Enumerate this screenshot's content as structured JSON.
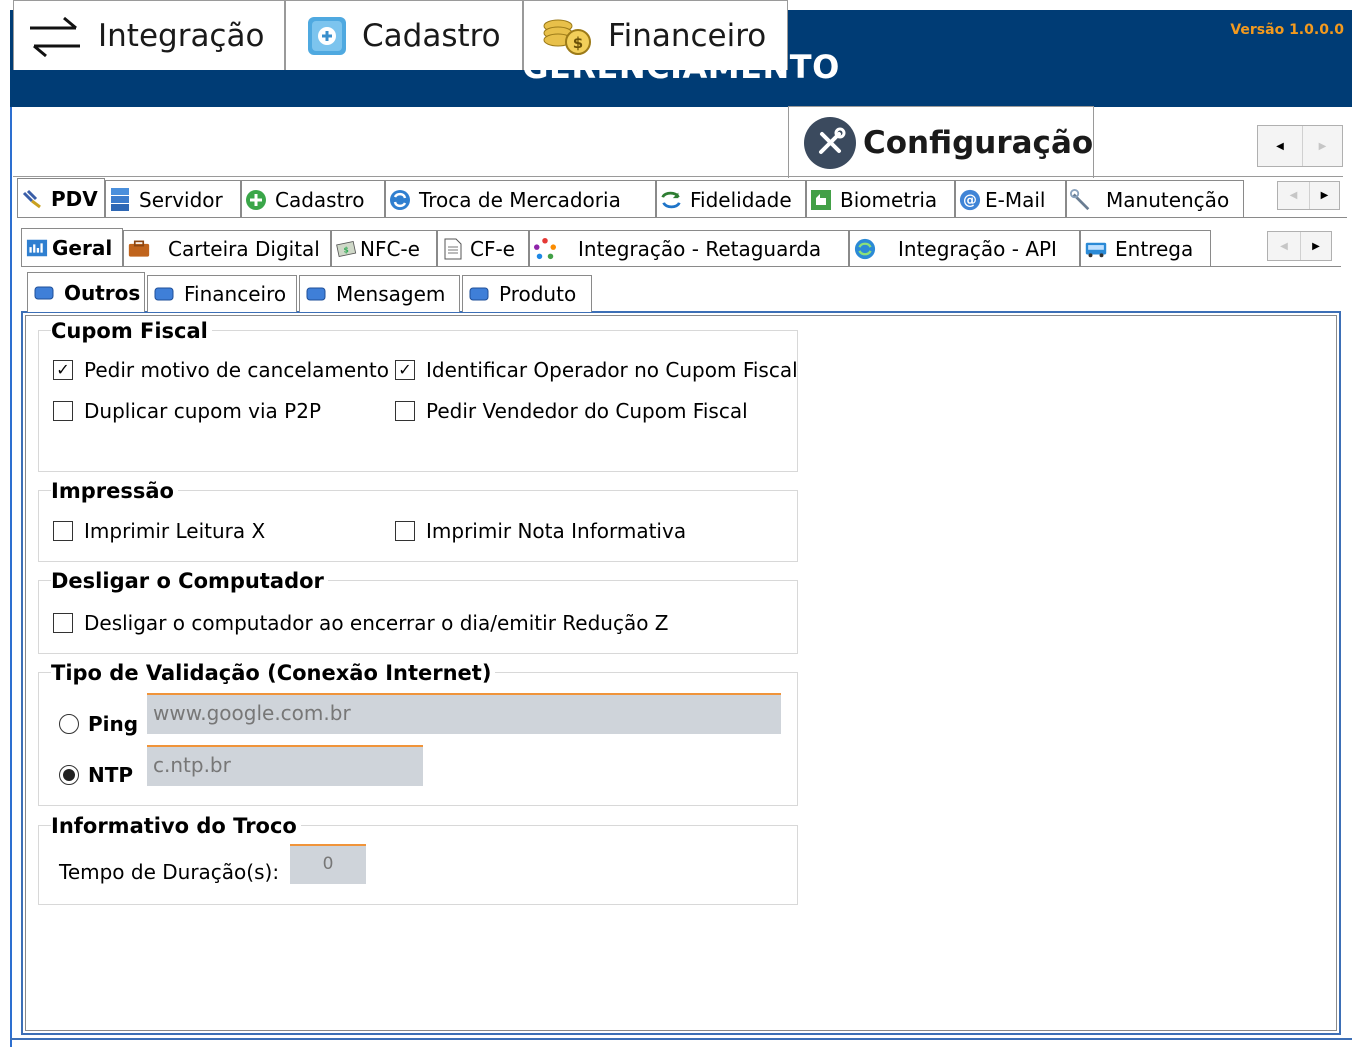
{
  "app": {
    "title": "GERENCIAMENTO",
    "version": "Versão 1.0.0.0",
    "brand_color": "#003c75",
    "accent_color": "#f39a1e"
  },
  "main_tabs": [
    {
      "label": "Integração",
      "icon": "arrows-exchange-icon"
    },
    {
      "label": "Cadastro",
      "icon": "add-record-icon"
    },
    {
      "label": "Financeiro",
      "icon": "coins-icon"
    },
    {
      "label": "Configuração",
      "icon": "tools-icon",
      "active": true
    }
  ],
  "sub_tabs": [
    {
      "label": "PDV",
      "icon": "pdv-icon",
      "active": true
    },
    {
      "label": "Servidor",
      "icon": "server-icon"
    },
    {
      "label": "Cadastro",
      "icon": "plus-circle-icon"
    },
    {
      "label": "Troca de Mercadoria",
      "icon": "swap-icon"
    },
    {
      "label": "Fidelidade",
      "icon": "loyalty-icon"
    },
    {
      "label": "Biometria",
      "icon": "biometrics-icon"
    },
    {
      "label": "E-Mail",
      "icon": "at-icon"
    },
    {
      "label": "Manutenção",
      "icon": "wrench-icon"
    }
  ],
  "pdv_tabs": [
    {
      "label": "Geral",
      "icon": "general-icon",
      "active": true
    },
    {
      "label": "Carteira Digital",
      "icon": "wallet-icon"
    },
    {
      "label": "NFC-e",
      "icon": "nfce-icon"
    },
    {
      "label": "CF-e",
      "icon": "document-icon"
    },
    {
      "label": "Integração - Retaguarda",
      "icon": "sync-dots-icon"
    },
    {
      "label": "Integração - API",
      "icon": "refresh-icon"
    },
    {
      "label": "Entrega",
      "icon": "delivery-icon"
    }
  ],
  "geral_tabs": [
    {
      "label": "Outros",
      "active": true
    },
    {
      "label": "Financeiro"
    },
    {
      "label": "Mensagem"
    },
    {
      "label": "Produto"
    }
  ],
  "cupom_fiscal": {
    "title": "Cupom Fiscal",
    "options": [
      {
        "label": "Pedir motivo de cancelamento",
        "checked": true
      },
      {
        "label": "Identificar Operador no Cupom Fiscal",
        "checked": true
      },
      {
        "label": "Duplicar cupom via P2P",
        "checked": false
      },
      {
        "label": "Pedir Vendedor do Cupom Fiscal",
        "checked": false
      }
    ]
  },
  "impressao": {
    "title": "Impressão",
    "options": [
      {
        "label": "Imprimir Leitura X",
        "checked": false
      },
      {
        "label": "Imprimir Nota Informativa",
        "checked": false
      }
    ]
  },
  "desligar": {
    "title": "Desligar o Computador",
    "option": {
      "label": "Desligar o computador ao encerrar o dia/emitir Redução Z",
      "checked": false
    }
  },
  "validacao": {
    "title": "Tipo de Validação (Conexão Internet)",
    "ping": {
      "label": "Ping",
      "selected": false,
      "value": "www.google.com.br"
    },
    "ntp": {
      "label": "NTP",
      "selected": true,
      "value": "c.ntp.br"
    }
  },
  "troco": {
    "title": "Informativo do Troco",
    "duration_label": "Tempo de Duração(s):",
    "duration_value": "0"
  }
}
